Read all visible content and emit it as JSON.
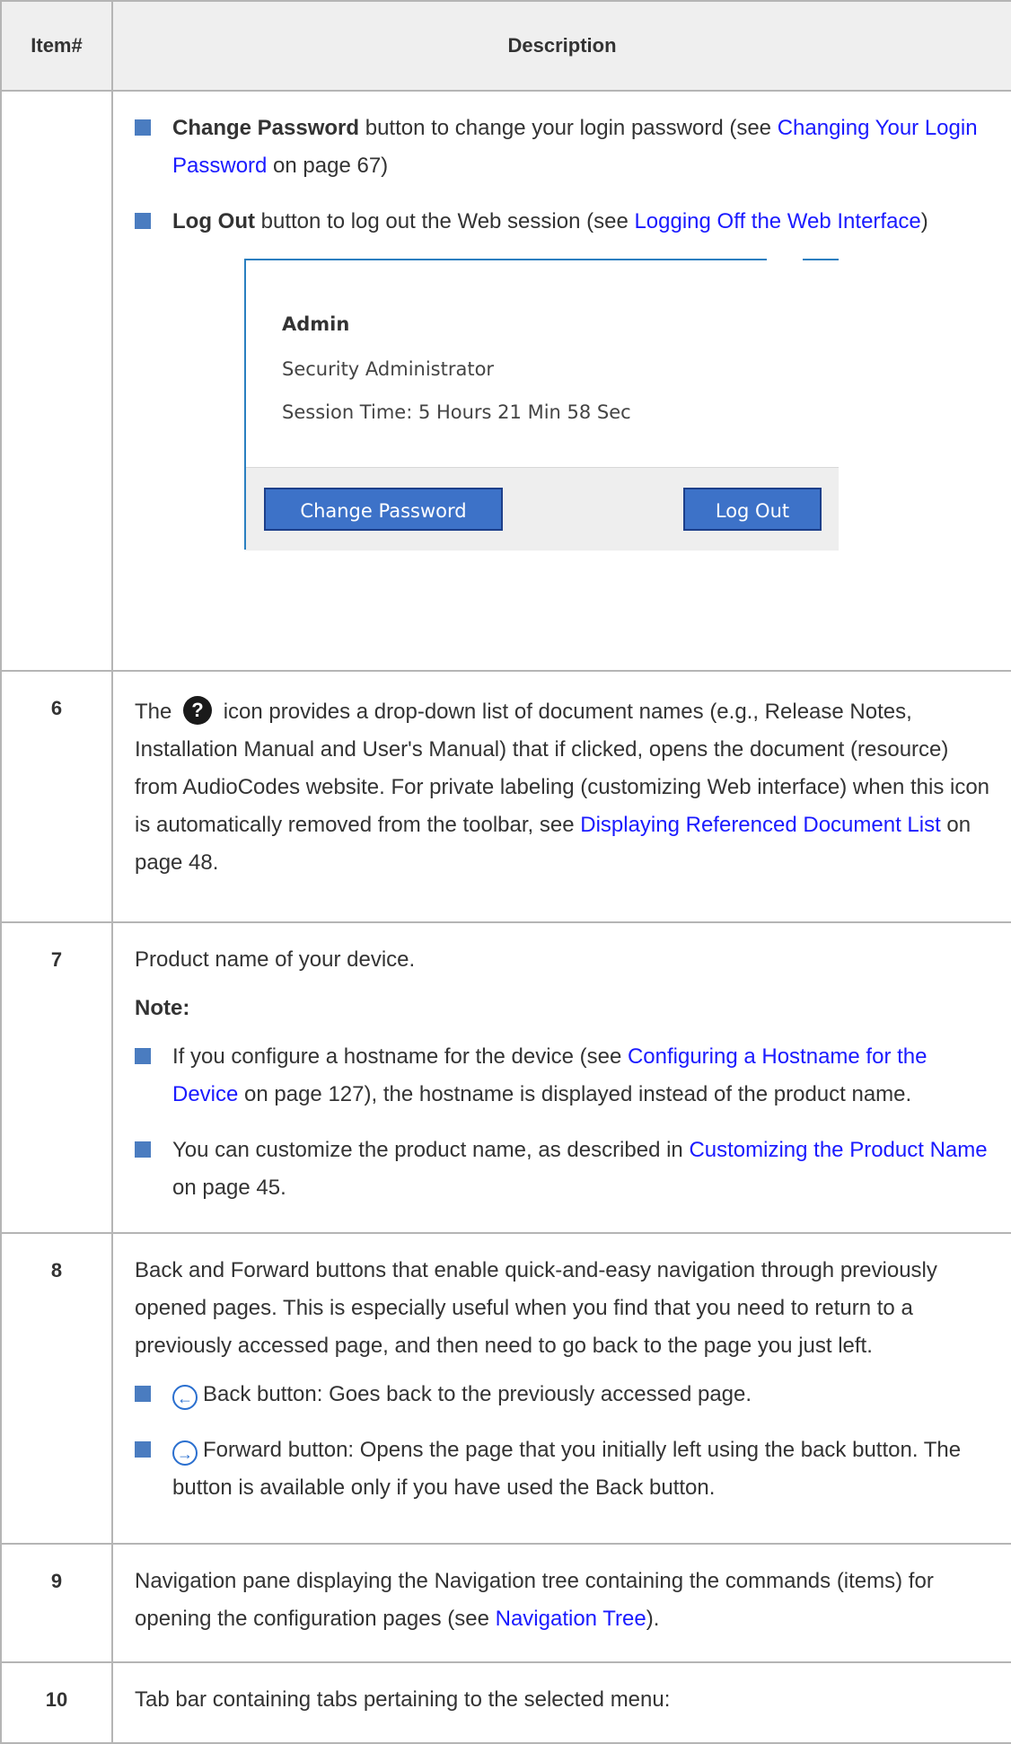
{
  "table": {
    "headers": {
      "item": "Item#",
      "description": "Description"
    }
  },
  "row_cont": {
    "bullets": [
      {
        "bold": "Change Password",
        "text1": " button to change your login password (see ",
        "link": "Changing Your Login Password",
        "text2": " on page 67)"
      },
      {
        "bold": "Log Out",
        "text1": " button to log out the Web session (see ",
        "link": "Logging Off the Web Interface",
        "text2": ")"
      }
    ],
    "panel": {
      "username": "Admin",
      "role": "Security Administrator",
      "session_time": "Session Time: 5 Hours 21 Min 58 Sec",
      "change_password_label": "Change Password",
      "log_out_label": "Log Out"
    }
  },
  "row6": {
    "num": "6",
    "text_before_icon": "The ",
    "icon_glyph": "?",
    "text_after_icon": " icon provides a drop-down list of document names (e.g., Release Notes, Installation Manual and User's Manual) that if clicked, opens the document (resource) from AudioCodes website. For private labeling (customizing Web interface) when this icon is automatically removed from the toolbar, see ",
    "link": "Displaying Referenced Document List",
    "text_end": " on page 48."
  },
  "row7": {
    "num": "7",
    "intro": "Product name of your device.",
    "note_label": "Note:",
    "bullets": [
      {
        "text1": "If you configure a hostname for the device (see ",
        "link": "Configuring a Hostname for the Device",
        "text2": " on page 127), the hostname is displayed instead of the product name."
      },
      {
        "text1": "You can customize the product name, as described in ",
        "link": "Customizing the Product Name",
        "text2": " on page 45."
      }
    ]
  },
  "row8": {
    "num": "8",
    "intro": "Back and Forward buttons that enable quick-and-easy navigation through previously opened pages. This is especially useful when you find that you need to return to a previously accessed page, and then need to go back to the page you just left.",
    "back_glyph": "←",
    "back_text": "Back button: Goes back to the previously accessed page.",
    "forward_glyph": "→",
    "forward_text": "Forward button: Opens the page that you initially left using the back button. The button is available only if you have used the Back button."
  },
  "row9": {
    "num": "9",
    "text1": "Navigation pane displaying the Navigation tree containing the commands (items) for opening the configuration pages (see ",
    "link": "Navigation Tree",
    "text2": ")."
  },
  "row10": {
    "num": "10",
    "text": "Tab bar containing tabs pertaining to the selected menu:"
  },
  "colors": {
    "link": "#1a1aff",
    "bullet": "#4a7cc0",
    "header_bg": "#efefef",
    "border": "#b5b5b5",
    "button_bg": "#3d72c8",
    "panel_accent": "#2a7fc0"
  }
}
